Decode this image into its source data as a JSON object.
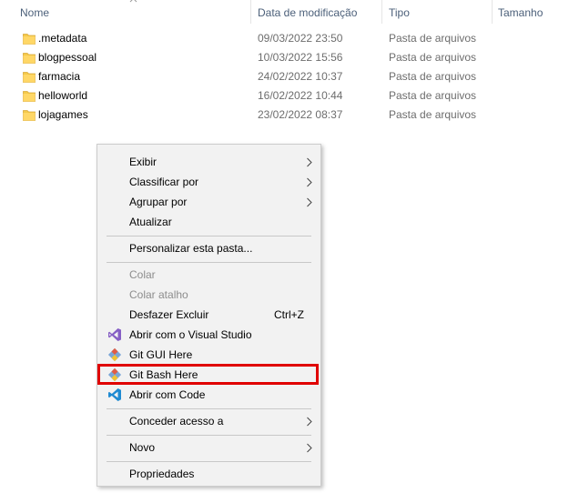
{
  "header": {
    "columns": [
      "Nome",
      "Data de modificação",
      "Tipo",
      "Tamanho"
    ]
  },
  "files": [
    {
      "name": ".metadata",
      "date": "09/03/2022 23:50",
      "type": "Pasta de arquivos"
    },
    {
      "name": "blogpessoal",
      "date": "10/03/2022 15:56",
      "type": "Pasta de arquivos"
    },
    {
      "name": "farmacia",
      "date": "24/02/2022 10:37",
      "type": "Pasta de arquivos"
    },
    {
      "name": "helloworld",
      "date": "16/02/2022 10:44",
      "type": "Pasta de arquivos"
    },
    {
      "name": "lojagames",
      "date": "23/02/2022 08:37",
      "type": "Pasta de arquivos"
    }
  ],
  "menu": {
    "exibir": "Exibir",
    "classificar": "Classificar por",
    "agrupar": "Agrupar por",
    "atualizar": "Atualizar",
    "personalizar": "Personalizar esta pasta...",
    "colar": "Colar",
    "colar_atalho": "Colar atalho",
    "desfazer": "Desfazer Excluir",
    "desfazer_shortcut": "Ctrl+Z",
    "visual_studio": "Abrir com o Visual Studio",
    "git_gui": "Git GUI Here",
    "git_bash": "Git Bash Here",
    "vscode": "Abrir com Code",
    "conceder": "Conceder acesso a",
    "novo": "Novo",
    "propriedades": "Propriedades"
  },
  "icons": {
    "folder": "folder-icon",
    "visual_studio": "visual-studio-icon",
    "git": "git-icon",
    "vscode": "vscode-icon",
    "submenu": "chevron-right-icon"
  },
  "colors": {
    "folder": "#f4c94a",
    "highlight_border": "#e00000",
    "header_text": "#4c607a",
    "disabled_text": "#8d8d8d"
  }
}
